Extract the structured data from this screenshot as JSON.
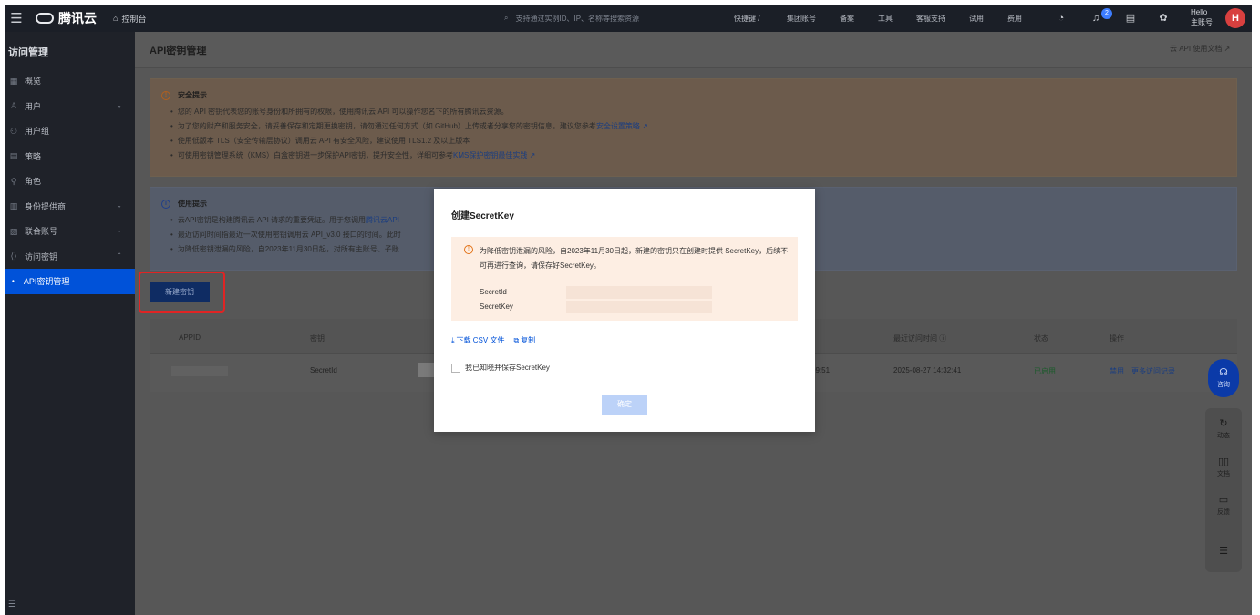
{
  "topbar": {
    "brand": "腾讯云",
    "console": "控制台",
    "search_placeholder": "支持通过实例ID、IP、名称等搜索资源",
    "nav": [
      "快捷键 /",
      "集团账号",
      "备案",
      "工具",
      "客服支持",
      "试用",
      "费用"
    ],
    "notification_count": "2",
    "user_line1": "Hello",
    "user_line2": "主账号",
    "avatar_letter": "H"
  },
  "sidebar": {
    "title": "访问管理",
    "items": [
      {
        "label": "概览",
        "icon": "overview-icon"
      },
      {
        "label": "用户",
        "icon": "user-icon",
        "expandable": true
      },
      {
        "label": "用户组",
        "icon": "group-icon"
      },
      {
        "label": "策略",
        "icon": "policy-icon"
      },
      {
        "label": "角色",
        "icon": "role-icon"
      },
      {
        "label": "身份提供商",
        "icon": "idp-icon",
        "expandable": true
      },
      {
        "label": "联合账号",
        "icon": "federated-icon",
        "expandable": true
      },
      {
        "label": "访问密钥",
        "icon": "key-icon",
        "expandable": true,
        "expanded": true
      },
      {
        "label": "API密钥管理",
        "active": true
      }
    ]
  },
  "page": {
    "title": "API密钥管理",
    "doc_link": "云 API 使用文档"
  },
  "security_notice": {
    "heading": "安全提示",
    "lines": [
      {
        "text": "您的 API 密钥代表您的账号身份和所拥有的权限，使用腾讯云 API 可以操作您名下的所有腾讯云资源。",
        "link": ""
      },
      {
        "text": "为了您的财产和服务安全，请妥善保存和定期更换密钥，请勿通过任何方式（如 GitHub）上传或者分享您的密钥信息。建议您参考",
        "link": "安全设置策略"
      },
      {
        "text": "使用低版本 TLS（安全传输层协议）调用云 API 有安全风险，建议使用 TLS1.2 及以上版本",
        "link": ""
      },
      {
        "text": "可使用密钥管理系统（KMS）白盒密钥进一步保护API密钥，提升安全性，详细可参考",
        "link": "KMS保护密钥最佳实践"
      }
    ]
  },
  "usage_notice": {
    "heading": "使用提示",
    "lines": [
      {
        "text": "云API密钥是构建腾讯云 API 请求的重要凭证。用于您调用",
        "link": "腾讯云API"
      },
      {
        "text": "最近访问时间指最近一次使用密钥调用云 API_v3.0 接口的时间。此时",
        "link": ""
      },
      {
        "text": "为降低密钥泄漏的风险，自2023年11月30日起，对所有主账号、子账",
        "link": ""
      }
    ]
  },
  "new_key_button": "新建密钥",
  "table": {
    "headers": [
      "APPID",
      "密钥",
      "最近访问时间",
      "状态",
      "操作"
    ],
    "row": {
      "key_type": "SecretId",
      "partial_time": "09:51",
      "last_access": "2025-08-27 14:32:41",
      "status": "已启用",
      "action_disable": "禁用",
      "action_more": "更多访问记录"
    }
  },
  "float_tools": {
    "consult": "咨询",
    "items": [
      {
        "label": "动态",
        "icon": "refresh-icon"
      },
      {
        "label": "文档",
        "icon": "book-icon"
      },
      {
        "label": "反馈",
        "icon": "feedback-icon"
      },
      {
        "label": "",
        "icon": "list-icon"
      }
    ]
  },
  "modal": {
    "title": "创建SecretKey",
    "warning": "为降低密钥泄漏的风险，自2023年11月30日起，新建的密钥只在创建时提供 SecretKey，后续不可再进行查询，请保存好SecretKey。",
    "label_secret_id": "SecretId",
    "label_secret_key": "SecretKey",
    "download_csv": "下载 CSV 文件",
    "copy": "复制",
    "checkbox_label": "我已知晓并保存SecretKey",
    "confirm": "确定"
  }
}
